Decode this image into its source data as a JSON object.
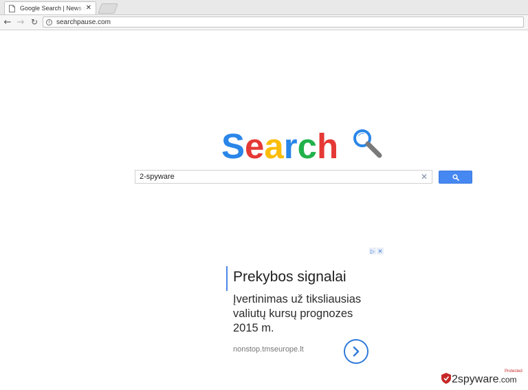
{
  "browser": {
    "tab_title": "Google Search | News se",
    "tab_close": "✕",
    "url": "searchpause.com",
    "info_icon": "i",
    "back": "←",
    "forward": "→",
    "reload": "↻"
  },
  "logo": {
    "letters": [
      {
        "char": "S",
        "color": "#2a86e8"
      },
      {
        "char": "e",
        "color": "#e53935"
      },
      {
        "char": "a",
        "color": "#fbbd08"
      },
      {
        "char": "r",
        "color": "#2a86e8"
      },
      {
        "char": "c",
        "color": "#21b14b"
      },
      {
        "char": "h",
        "color": "#e53935"
      }
    ],
    "icon": "magnifier-icon"
  },
  "search": {
    "value": "2-spyware",
    "clear": "✕",
    "button_icon": "search-icon"
  },
  "ad": {
    "title": "Prekybos signalai",
    "description_lines": [
      "Įvertinimas už tiksliausias",
      "valiutų kursų prognozes",
      "2015 m."
    ],
    "display_url": "nonstop.tmseurope.lt",
    "adchoices_icons": [
      "adchoices-icon",
      "close-icon"
    ]
  },
  "watermark": {
    "text": "2spyware",
    "suffix": ".com",
    "subtext": "Protected",
    "color_red": "#c62828"
  }
}
